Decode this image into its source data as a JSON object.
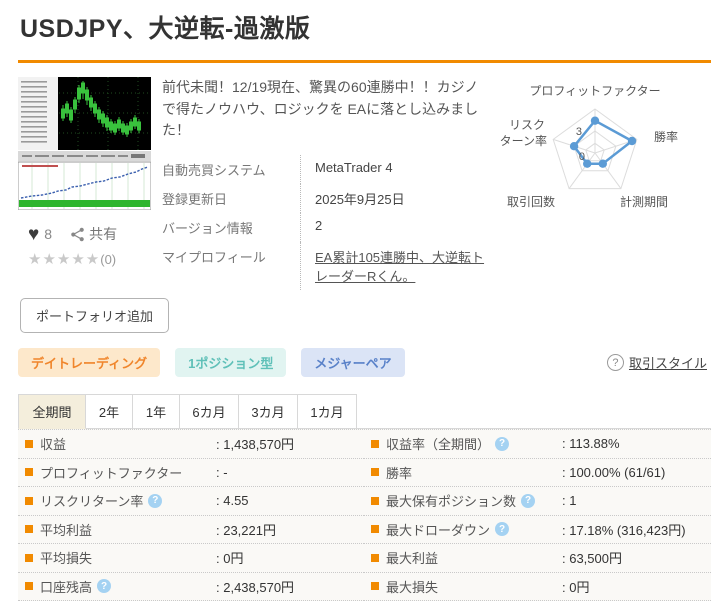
{
  "page_title": "USDJPY、大逆転-過激版",
  "product_card": {
    "likes_count": "8",
    "share_label": "共有",
    "stars": "★★★★★",
    "review_count": "(0)",
    "description": "前代未聞！12/19現在、驚異の60連勝中！！カジノで得たノウハウ、ロジックを EAに落とし込みました！",
    "details": [
      {
        "label": "自動売買システム",
        "value": "MetaTrader 4"
      },
      {
        "label": "登録更新日",
        "value": "2025年9月25日"
      },
      {
        "label": "バージョン情報",
        "value": "2"
      },
      {
        "label": "マイプロフィール",
        "value": "EA累計105連勝中、大逆転トレーダーRくん。"
      }
    ],
    "portfolio_button_label": "ポートフォリオ追加",
    "tags": [
      {
        "label": "デイトレーディング",
        "text_color": "#f0862c",
        "bg_color": "#fde8cb"
      },
      {
        "label": "1ポジション型",
        "text_color": "#5fc0b8",
        "bg_color": "#e1f4f1"
      },
      {
        "label": "メジャーペア",
        "text_color": "#5a82c9",
        "bg_color": "#dbe4f6"
      }
    ],
    "trade_style_link_label": "取引スタイル",
    "trade_style_help_glyph": "?"
  },
  "chart_data": {
    "type": "radar",
    "axes": [
      "プロフィットファクター",
      "勝率",
      "計測期間",
      "取引回数",
      "リスクターン率"
    ],
    "axis_left_lines": [
      "リスク",
      "ターン率"
    ],
    "values": [
      4.4,
      5.3,
      1.8,
      1.8,
      3.0
    ],
    "scale_max": 6,
    "scale_label_mid": "3",
    "scale_label_center": "0",
    "line_color": "#5b9bd5",
    "grid_color": "#dcdcdc"
  },
  "period_tabs": [
    {
      "label": "全期間",
      "active": true
    },
    {
      "label": "2年",
      "active": false
    },
    {
      "label": "1年",
      "active": false
    },
    {
      "label": "6カ月",
      "active": false
    },
    {
      "label": "3カ月",
      "active": false
    },
    {
      "label": "1カ月",
      "active": false
    }
  ],
  "stats_table": {
    "left_rows": [
      {
        "label": "収益",
        "value": ": 1,438,570円",
        "has_help": false
      },
      {
        "label": "プロフィットファクター",
        "value": ": -",
        "has_help": false
      },
      {
        "label": "リスクリターン率",
        "value": ": 4.55",
        "has_help": true
      },
      {
        "label": "平均利益",
        "value": ": 23,221円",
        "has_help": false
      },
      {
        "label": "平均損失",
        "value": ": 0円",
        "has_help": false
      },
      {
        "label": "口座残高",
        "value": ": 2,438,570円",
        "has_help": true
      }
    ],
    "right_rows": [
      {
        "label": "収益率（全期間）",
        "value": ": 113.88%",
        "has_help": true
      },
      {
        "label": "勝率",
        "value": ": 100.00% (61/61)",
        "has_help": false
      },
      {
        "label": "最大保有ポジション数",
        "value": ": 1",
        "has_help": true
      },
      {
        "label": "最大ドローダウン",
        "value": ": 17.18% (316,423円)",
        "has_help": true
      },
      {
        "label": "最大利益",
        "value": ": 63,500円",
        "has_help": false
      },
      {
        "label": "最大損失",
        "value": ": 0円",
        "has_help": false
      }
    ],
    "help_glyph": "?"
  },
  "colors": {
    "accent_orange": "#f18a00",
    "radar_blue": "#5b9bd5",
    "tab_active_bg": "#f4eedc",
    "help_icon_bg": "#a4d2f2"
  }
}
